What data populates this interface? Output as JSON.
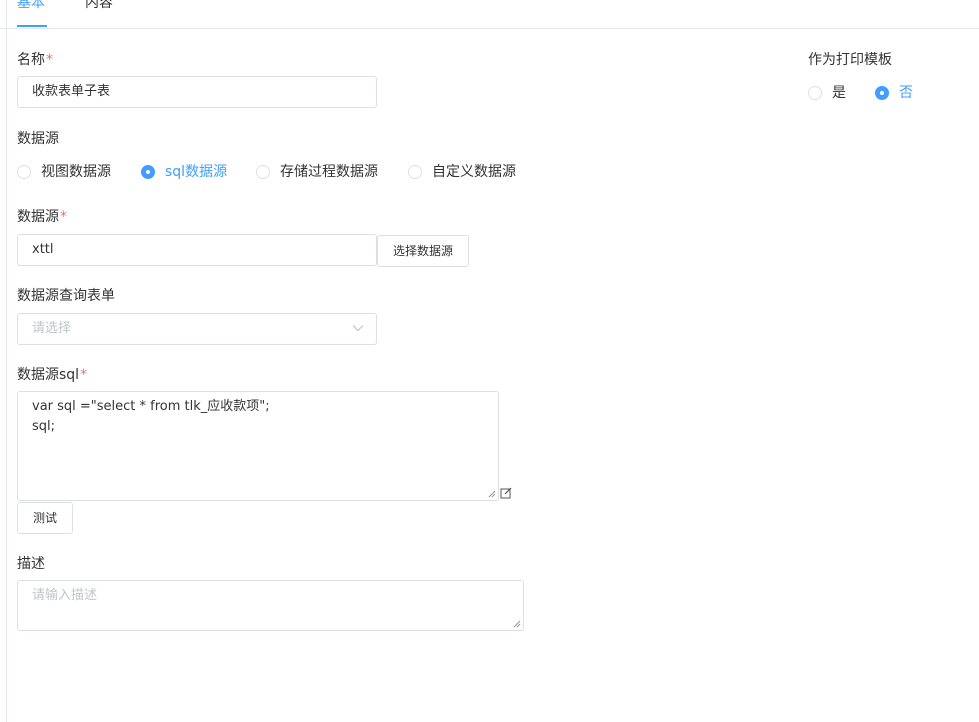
{
  "tabs": [
    {
      "label": "基本",
      "active": true
    },
    {
      "label": "内容",
      "active": false
    }
  ],
  "form": {
    "name_label": "名称",
    "name_value": "收款表单子表",
    "print_template_label": "作为打印模板",
    "print_template_options": [
      {
        "label": "是",
        "checked": false
      },
      {
        "label": "否",
        "checked": true
      }
    ],
    "datasource_type_label": "数据源",
    "datasource_type_options": [
      {
        "label": "视图数据源",
        "checked": false
      },
      {
        "label": "sql数据源",
        "checked": true
      },
      {
        "label": "存储过程数据源",
        "checked": false
      },
      {
        "label": "自定义数据源",
        "checked": false
      }
    ],
    "datasource_label": "数据源",
    "datasource_value": "xttl",
    "select_datasource_button": "选择数据源",
    "query_form_label": "数据源查询表单",
    "query_form_placeholder": "请选择",
    "sql_label": "数据源sql",
    "sql_lines": [
      "var sql =\"select * from tlk_应收款项\";",
      "sql;"
    ],
    "test_button": "测试",
    "description_label": "描述",
    "description_placeholder": "请输入描述",
    "required_mark": "*"
  },
  "colors": {
    "accent": "#409eff",
    "required": "#f56c6c",
    "border": "#dcdfe6",
    "placeholder": "#c0c4cc"
  },
  "icons": {
    "select_arrow": "chevron-down-icon",
    "editor": "edit-icon",
    "resize": "resize-grip-icon"
  }
}
